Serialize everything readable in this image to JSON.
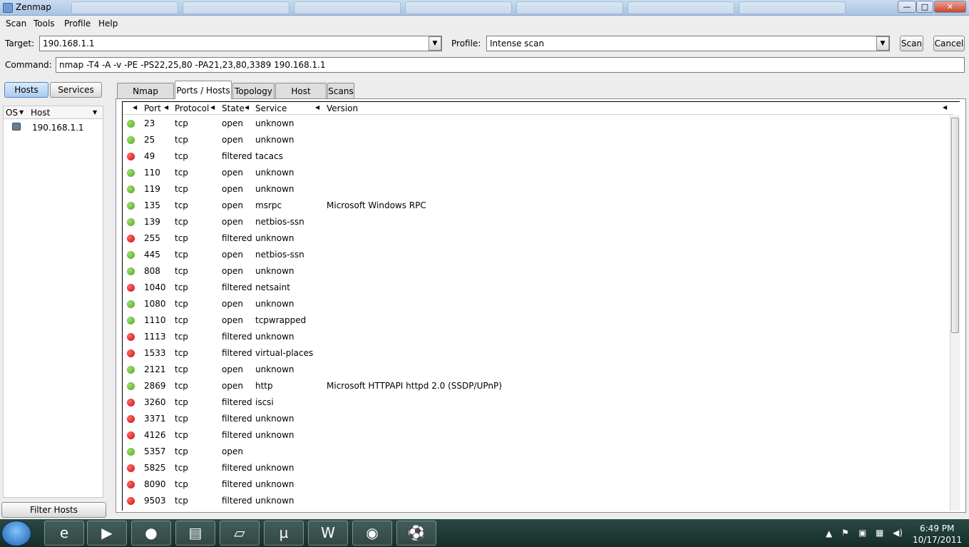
{
  "window": {
    "title": "Zenmap",
    "controls": {
      "minimize": "—",
      "maximize": "□",
      "close": "✕"
    }
  },
  "menu": [
    "Scan",
    "Tools",
    "Profile",
    "Help"
  ],
  "target": {
    "label": "Target:",
    "value": "190.168.1.1"
  },
  "profile": {
    "label": "Profile:",
    "value": "Intense scan"
  },
  "buttons": {
    "scan": "Scan",
    "cancel": "Cancel",
    "filter_hosts": "Filter Hosts"
  },
  "command": {
    "label": "Command:",
    "value": "nmap -T4 -A -v -PE -PS22,25,80 -PA21,23,80,3389 190.168.1.1"
  },
  "left_tabs": {
    "hosts": "Hosts",
    "services": "Services"
  },
  "host_list": {
    "headers": {
      "os": "OS",
      "host": "Host"
    },
    "hosts": [
      {
        "name": "190.168.1.1"
      }
    ]
  },
  "tabs": [
    {
      "label": "Nmap Output",
      "selected": false
    },
    {
      "label": "Ports / Hosts",
      "selected": true
    },
    {
      "label": "Topology",
      "selected": false
    },
    {
      "label": "Host Details",
      "selected": false
    },
    {
      "label": "Scans",
      "selected": false
    }
  ],
  "ports_table": {
    "headers": {
      "port": "Port",
      "protocol": "Protocol",
      "state": "State",
      "service": "Service",
      "version": "Version"
    },
    "rows": [
      {
        "port": "23",
        "protocol": "tcp",
        "state": "open",
        "service": "unknown",
        "version": ""
      },
      {
        "port": "25",
        "protocol": "tcp",
        "state": "open",
        "service": "unknown",
        "version": ""
      },
      {
        "port": "49",
        "protocol": "tcp",
        "state": "filtered",
        "service": "tacacs",
        "version": ""
      },
      {
        "port": "110",
        "protocol": "tcp",
        "state": "open",
        "service": "unknown",
        "version": ""
      },
      {
        "port": "119",
        "protocol": "tcp",
        "state": "open",
        "service": "unknown",
        "version": ""
      },
      {
        "port": "135",
        "protocol": "tcp",
        "state": "open",
        "service": "msrpc",
        "version": "Microsoft Windows RPC"
      },
      {
        "port": "139",
        "protocol": "tcp",
        "state": "open",
        "service": "netbios-ssn",
        "version": ""
      },
      {
        "port": "255",
        "protocol": "tcp",
        "state": "filtered",
        "service": "unknown",
        "version": ""
      },
      {
        "port": "445",
        "protocol": "tcp",
        "state": "open",
        "service": "netbios-ssn",
        "version": ""
      },
      {
        "port": "808",
        "protocol": "tcp",
        "state": "open",
        "service": "unknown",
        "version": ""
      },
      {
        "port": "1040",
        "protocol": "tcp",
        "state": "filtered",
        "service": "netsaint",
        "version": ""
      },
      {
        "port": "1080",
        "protocol": "tcp",
        "state": "open",
        "service": "unknown",
        "version": ""
      },
      {
        "port": "1110",
        "protocol": "tcp",
        "state": "open",
        "service": "tcpwrapped",
        "version": ""
      },
      {
        "port": "1113",
        "protocol": "tcp",
        "state": "filtered",
        "service": "unknown",
        "version": ""
      },
      {
        "port": "1533",
        "protocol": "tcp",
        "state": "filtered",
        "service": "virtual-places",
        "version": ""
      },
      {
        "port": "2121",
        "protocol": "tcp",
        "state": "open",
        "service": "unknown",
        "version": ""
      },
      {
        "port": "2869",
        "protocol": "tcp",
        "state": "open",
        "service": "http",
        "version": "Microsoft HTTPAPI httpd 2.0 (SSDP/UPnP)"
      },
      {
        "port": "3260",
        "protocol": "tcp",
        "state": "filtered",
        "service": "iscsi",
        "version": ""
      },
      {
        "port": "3371",
        "protocol": "tcp",
        "state": "filtered",
        "service": "unknown",
        "version": ""
      },
      {
        "port": "4126",
        "protocol": "tcp",
        "state": "filtered",
        "service": "unknown",
        "version": ""
      },
      {
        "port": "5357",
        "protocol": "tcp",
        "state": "open",
        "service": "",
        "version": ""
      },
      {
        "port": "5825",
        "protocol": "tcp",
        "state": "filtered",
        "service": "unknown",
        "version": ""
      },
      {
        "port": "8090",
        "protocol": "tcp",
        "state": "filtered",
        "service": "unknown",
        "version": ""
      },
      {
        "port": "9503",
        "protocol": "tcp",
        "state": "filtered",
        "service": "unknown",
        "version": ""
      }
    ]
  },
  "taskbar": {
    "apps": [
      "internet-explorer-icon",
      "media-center-icon",
      "firefox-icon",
      "file-explorer-icon",
      "sticky-notes-icon",
      "utorrent-icon",
      "word-icon",
      "zenmap-eye-icon",
      "soccer-ball-icon"
    ],
    "clock": {
      "time": "6:49 PM",
      "date": "10/17/2011"
    }
  },
  "colors": {
    "open": "#4aa81c",
    "filtered": "#c80d0d",
    "accent": "#4f86c4"
  }
}
